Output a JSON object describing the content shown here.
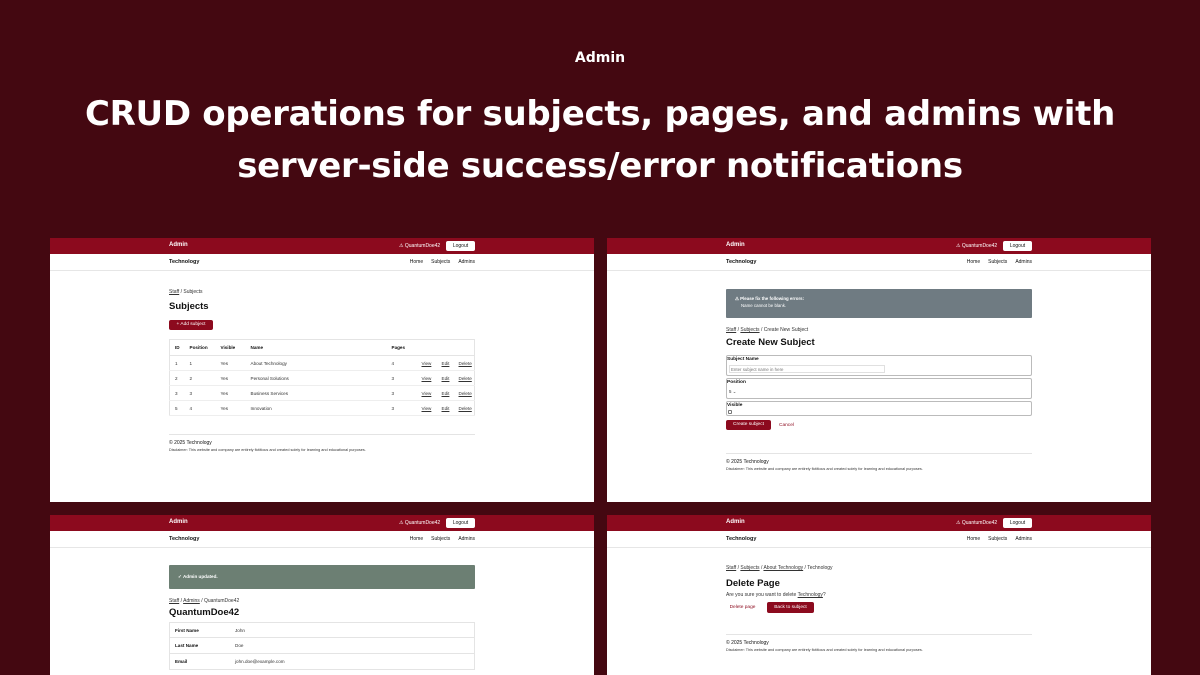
{
  "hero": {
    "label": "Admin",
    "title_line1": "CRUD operations for subjects, pages, and admins with",
    "title_line2": "server-side  success/error notifications"
  },
  "colors": {
    "background": "#440811",
    "topbar": "#8c0a1e",
    "primary_button": "#8c0a1e",
    "error_alert": "#6f7b82",
    "success_alert": "#6c7f73"
  },
  "chrome": {
    "brand": "Admin",
    "user": "⚠ QuantumDoe42",
    "logout": "Logout",
    "site": "Technology",
    "nav": [
      "Home",
      "Subjects",
      "Admins"
    ],
    "footer_copy": "© 2025 Technology",
    "footer_disclaimer": "Disclaimer: This website and company are entirely fictitious and created solely for learning and educational purposes."
  },
  "subjects_panel": {
    "crumb_staff": "Staff",
    "crumb_sep": "/",
    "crumb_current": "Subjects",
    "title": "Subjects",
    "add_button": "+ Add subject",
    "columns": [
      "ID",
      "Position",
      "Visible",
      "Name",
      "Pages",
      "",
      "",
      ""
    ],
    "rows": [
      [
        "1",
        "1",
        "Yes",
        "About Technology",
        "4",
        "View",
        "Edit",
        "Delete"
      ],
      [
        "2",
        "2",
        "Yes",
        "Personal Solutions",
        "3",
        "View",
        "Edit",
        "Delete"
      ],
      [
        "3",
        "3",
        "Yes",
        "Business Services",
        "3",
        "View",
        "Edit",
        "Delete"
      ],
      [
        "5",
        "4",
        "Yes",
        "Innovation",
        "3",
        "View",
        "Edit",
        "Delete"
      ]
    ]
  },
  "create_panel": {
    "error_title": "⚠ Please fix the following errors:",
    "error_item": "Name cannot be blank.",
    "crumb_staff": "Staff",
    "crumb_subjects": "Subjects",
    "crumb_current": "Create New Subject",
    "title": "Create New Subject",
    "name_label": "Subject Name",
    "name_placeholder": "Enter subject name in here",
    "position_label": "Position",
    "position_value": "5 ⌄",
    "visible_label": "Visible",
    "submit": "Create subject",
    "cancel": "Cancel"
  },
  "admin_panel": {
    "success": "✓ Admin updated.",
    "crumb_staff": "Staff",
    "crumb_admins": "Admins",
    "crumb_current": "QuantumDoe42",
    "title": "QuantumDoe42",
    "fields": [
      {
        "label": "First Name",
        "value": "John"
      },
      {
        "label": "Last Name",
        "value": "Doe"
      },
      {
        "label": "Email",
        "value": "john.doe@example.com"
      }
    ]
  },
  "delete_panel": {
    "crumb_staff": "Staff",
    "crumb_subjects": "Subjects",
    "crumb_about": "About Technology",
    "crumb_current": "Technology",
    "title": "Delete Page",
    "confirm_prefix": "Are you sure you want to delete ",
    "confirm_target": "Technology",
    "confirm_suffix": "?",
    "delete_button": "Delete page",
    "back_button": "Back to subject"
  }
}
